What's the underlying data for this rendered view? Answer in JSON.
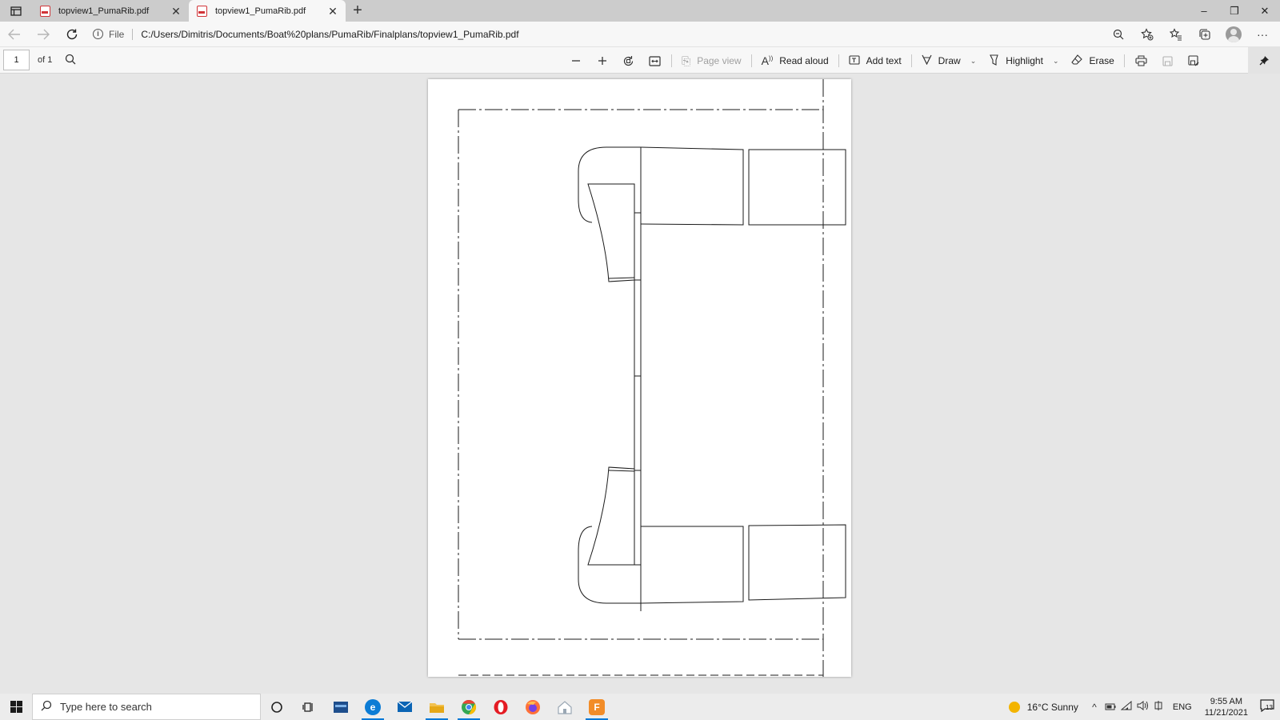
{
  "browser": {
    "tabs": [
      {
        "title": "topview1_PumaRib.pdf",
        "active": false
      },
      {
        "title": "topview1_PumaRib.pdf",
        "active": true
      }
    ],
    "new_tab_label": "+",
    "window_controls": {
      "minimize": "–",
      "restore": "❐",
      "close": "✕"
    }
  },
  "address_bar": {
    "protocol_label": "File",
    "url": "C:/Users/Dimitris/Documents/Boat%20plans/PumaRib/Finalplans/topview1_PumaRib.pdf"
  },
  "pdf_toolbar": {
    "page_number": "1",
    "page_total": "of 1",
    "page_view_label": "Page view",
    "read_aloud_label": "Read aloud",
    "add_text_label": "Add text",
    "draw_label": "Draw",
    "highlight_label": "Highlight",
    "erase_label": "Erase"
  },
  "taskbar": {
    "search_placeholder": "Type here to search",
    "weather": "16°C  Sunny",
    "language": "ENG",
    "time": "9:55 AM",
    "date": "11/21/2021",
    "notification_count": "13",
    "colors": {
      "edge": "#0c7cd5",
      "mail": "#0a64b4",
      "explorer": "#f2c14e",
      "chrome": "#34a853",
      "opera": "#e41b23",
      "firefox": "#ff7139",
      "f_app": "#f28c28"
    }
  }
}
